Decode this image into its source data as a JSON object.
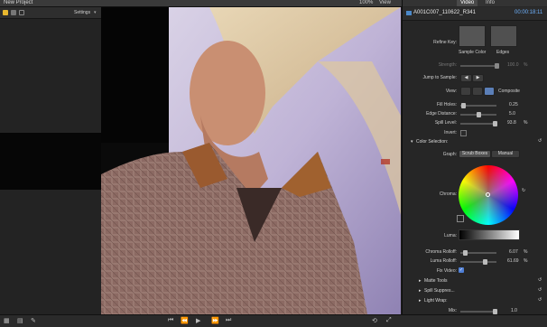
{
  "app": {
    "project_title": "New Project",
    "zoom": "100%",
    "view_label": "View",
    "settings_label": "Settings"
  },
  "inspector": {
    "tabs": [
      "Video",
      "Info"
    ],
    "clip_name": "A001C007_110622_R341",
    "clip_time": "00:00:18:11",
    "refine_key_label": "Refine Key:",
    "sample_color_label": "Sample Color",
    "edges_label": "Edges",
    "strength_label": "Strength:",
    "strength_value": "100.0",
    "jump_label": "Jump to Sample:",
    "view_label": "View:",
    "view_mode": "Composite",
    "fill_holes_label": "Fill Holes:",
    "fill_holes_value": "0.25",
    "edge_distance_label": "Edge Distance:",
    "edge_distance_value": "5.0",
    "spill_level_label": "Spill Level:",
    "spill_level_value": "93.8",
    "invert_label": "Invert:",
    "color_selection_label": "Color Selection:",
    "graph_label": "Graph:",
    "graph_options": [
      "Scrub Boxes",
      "Manual"
    ],
    "chroma_label": "Chroma:",
    "luma_label": "Luma:",
    "chroma_rolloff_label": "Chroma Rolloff:",
    "chroma_rolloff_value": "6.07",
    "luma_rolloff_label": "Luma Rolloff:",
    "luma_rolloff_value": "61.69",
    "fix_video_label": "Fix Video:",
    "matte_tools_label": "Matte Tools",
    "spill_suppress_label": "Spill Suppres...",
    "light_wrap_label": "Light Wrap:",
    "mix_label": "Mix:",
    "mix_value": "1.0",
    "pct": "%",
    "strength_pct": "%",
    "spill_pct": "%",
    "luma_pct": "%"
  }
}
